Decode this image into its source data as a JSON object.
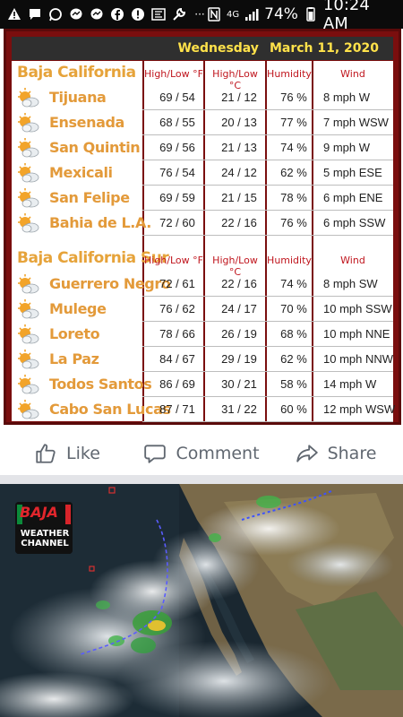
{
  "status_bar": {
    "left_icons": [
      "warning-icon",
      "message-icon",
      "whatsapp-icon",
      "messenger-icon",
      "messenger-icon",
      "facebook-icon",
      "alert-icon",
      "nfc-icon",
      "wrench-icon",
      "more-icon"
    ],
    "more_dots": "···",
    "network": "4G",
    "battery": "74%",
    "time": "10:24 AM"
  },
  "weather": {
    "date_day": "Wednesday",
    "date": "March 11, 2020",
    "headers": {
      "hilo_f": "High/Low °F",
      "hilo_c": "High/Low °C",
      "humidity": "Humidity",
      "wind": "Wind"
    },
    "sections": [
      {
        "title": "Baja California",
        "rows": [
          {
            "city": "Tijuana",
            "f": "69 / 54",
            "c": "21 / 12",
            "hum": "76 %",
            "wind": "8 mph  W",
            "icon": "partly-cloudy"
          },
          {
            "city": "Ensenada",
            "f": "68 / 55",
            "c": "20 / 13",
            "hum": "77 %",
            "wind": "7 mph  WSW",
            "icon": "partly-cloudy"
          },
          {
            "city": "San Quintin",
            "f": "69 / 56",
            "c": "21 / 13",
            "hum": "74 %",
            "wind": "9 mph  W",
            "icon": "partly-cloudy"
          },
          {
            "city": "Mexicali",
            "f": "76 / 54",
            "c": "24 / 12",
            "hum": "62 %",
            "wind": "5 mph  ESE",
            "icon": "partly-cloudy"
          },
          {
            "city": "San Felipe",
            "f": "69 / 59",
            "c": "21 / 15",
            "hum": "78 %",
            "wind": "6 mph  ENE",
            "icon": "partly-cloudy"
          },
          {
            "city": "Bahia de L.A.",
            "f": "72 / 60",
            "c": "22 / 16",
            "hum": "76 %",
            "wind": "6 mph  SSW",
            "icon": "partly-cloudy"
          }
        ]
      },
      {
        "title": "Baja California Sur",
        "rows": [
          {
            "city": "Guerrero Negro",
            "f": "72 / 61",
            "c": "22 / 16",
            "hum": "74 %",
            "wind": "8 mph  SW",
            "icon": "partly-cloudy"
          },
          {
            "city": "Mulege",
            "f": "76 / 62",
            "c": "24 / 17",
            "hum": "70 %",
            "wind": "10 mph  SSW",
            "icon": "partly-cloudy"
          },
          {
            "city": "Loreto",
            "f": "78 / 66",
            "c": "26 / 19",
            "hum": "68 %",
            "wind": "10 mph  NNE",
            "icon": "partly-cloudy"
          },
          {
            "city": "La Paz",
            "f": "84 / 67",
            "c": "29 / 19",
            "hum": "62 %",
            "wind": "10 mph  NNW",
            "icon": "partly-cloudy"
          },
          {
            "city": "Todos Santos",
            "f": "86 / 69",
            "c": "30 / 21",
            "hum": "58 %",
            "wind": "14 mph  W",
            "icon": "partly-cloudy"
          },
          {
            "city": "Cabo San Lucas",
            "f": "87 / 71",
            "c": "31 / 22",
            "hum": "60 %",
            "wind": "12 mph  WSW",
            "icon": "partly-cloudy"
          }
        ]
      }
    ]
  },
  "actions": {
    "like": "Like",
    "comment": "Comment",
    "share": "Share"
  },
  "satellite": {
    "logo_title": "BAJA",
    "logo_line1": "WEATHER",
    "logo_line2": "CHANNEL"
  },
  "colors": {
    "card_border": "#7a0e0e",
    "section_title": "#e6a33a",
    "header_red": "#c0161e",
    "date_yellow": "#ffe24a"
  }
}
